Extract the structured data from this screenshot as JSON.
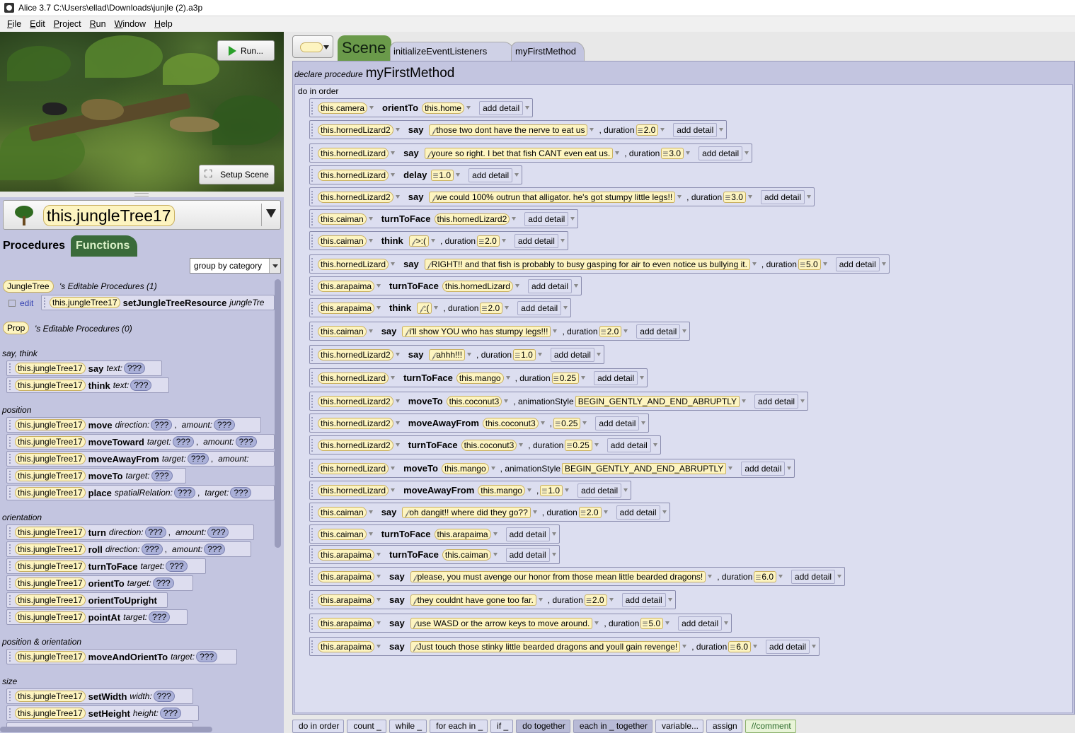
{
  "window": {
    "title": "Alice 3.7 C:\\Users\\ellad\\Downloads\\junjle (2).a3p"
  },
  "menu": [
    "File",
    "Edit",
    "Project",
    "Run",
    "Window",
    "Help"
  ],
  "scene_view": {
    "run_label": "Run...",
    "setup_label": "Setup Scene"
  },
  "selector": {
    "name": "this.jungleTree17"
  },
  "left_tabs": {
    "procedures": "Procedures",
    "functions": "Functions"
  },
  "group_by": "group by category",
  "editable": {
    "type1": "JungleTree",
    "type1_text": "'s Editable Procedures (1)",
    "edit_label": "edit",
    "proc_obj": "this.jungleTree17",
    "proc_name": "setJungleTreeResource",
    "proc_param": "jungleTre",
    "type2": "Prop",
    "type2_text": "'s Editable Procedures (0)"
  },
  "categories": {
    "say_think": "say, think",
    "position": "position",
    "orientation": "orientation",
    "pos_orient": "position & orientation",
    "size": "size"
  },
  "left_procs": {
    "obj": "this.jungleTree17",
    "q": "???",
    "say": {
      "name": "say",
      "param": "text:"
    },
    "think": {
      "name": "think",
      "param": "text:"
    },
    "move": {
      "name": "move",
      "p1": "direction:",
      "p2": "amount:"
    },
    "moveToward": {
      "name": "moveToward",
      "p1": "target:",
      "p2": "amount:"
    },
    "moveAwayFrom": {
      "name": "moveAwayFrom",
      "p1": "target:",
      "p2": "amount:"
    },
    "moveTo": {
      "name": "moveTo",
      "p1": "target:"
    },
    "place": {
      "name": "place",
      "p1": "spatialRelation:",
      "p2": "target:"
    },
    "turn": {
      "name": "turn",
      "p1": "direction:",
      "p2": "amount:"
    },
    "roll": {
      "name": "roll",
      "p1": "direction:",
      "p2": "amount:"
    },
    "turnToFace": {
      "name": "turnToFace",
      "p1": "target:"
    },
    "orientTo": {
      "name": "orientTo",
      "p1": "target:"
    },
    "orientToUpright": {
      "name": "orientToUpright"
    },
    "pointAt": {
      "name": "pointAt",
      "p1": "target:"
    },
    "moveAndOrientTo": {
      "name": "moveAndOrientTo",
      "p1": "target:"
    },
    "setWidth": {
      "name": "setWidth",
      "p1": "width:"
    },
    "setHeight": {
      "name": "setHeight",
      "p1": "height:"
    }
  },
  "editor_tabs": {
    "scene": "Scene",
    "init": "initializeEventListeners",
    "first": "myFirstMethod"
  },
  "declare": {
    "prefix": "declare procedure",
    "name": "myFirstMethod"
  },
  "do_in_order": "do in order",
  "add_detail": "add detail",
  "kw": {
    "duration": ", duration",
    "anim": ", animationStyle"
  },
  "statements": [
    {
      "obj": "this.camera",
      "method": "orientTo",
      "arg": "this.home"
    },
    {
      "obj": "this.hornedLizard2",
      "method": "say",
      "text": "those two dont have the nerve to eat us",
      "duration": "2.0"
    },
    {
      "obj": "this.hornedLizard",
      "method": "say",
      "text": "youre so right. I bet that fish CANT even eat us.",
      "duration": "3.0"
    },
    {
      "obj": "this.hornedLizard",
      "method": "delay",
      "num": "1.0"
    },
    {
      "obj": "this.hornedLizard2",
      "method": "say",
      "text": "we could 100% outrun that alligator. he's got stumpy little legs!!",
      "duration": "3.0"
    },
    {
      "obj": "this.caiman",
      "method": "turnToFace",
      "arg": "this.hornedLizard2"
    },
    {
      "obj": "this.caiman",
      "method": "think",
      "text": ">:(",
      "duration": "2.0"
    },
    {
      "obj": "this.hornedLizard",
      "method": "say",
      "text": "RIGHT!! and that fish is probably to busy gasping for air to even notice us bullying it.",
      "duration": "5.0"
    },
    {
      "obj": "this.arapaima",
      "method": "turnToFace",
      "arg": "this.hornedLizard"
    },
    {
      "obj": "this.arapaima",
      "method": "think",
      "text": ":(",
      "duration": "2.0"
    },
    {
      "obj": "this.caiman",
      "method": "say",
      "text": "i'll show YOU who has stumpy legs!!!",
      "duration": "2.0"
    },
    {
      "obj": "this.hornedLizard2",
      "method": "say",
      "text": "ahhh!!!",
      "duration": "1.0"
    },
    {
      "obj": "this.hornedLizard",
      "method": "turnToFace",
      "arg": "this.mango",
      "duration": "0.25"
    },
    {
      "obj": "this.hornedLizard2",
      "method": "moveTo",
      "arg": "this.coconut3",
      "anim": "BEGIN_GENTLY_AND_END_ABRUPTLY"
    },
    {
      "obj": "this.hornedLizard2",
      "method": "moveAwayFrom",
      "arg": "this.coconut3",
      "num": "0.25"
    },
    {
      "obj": "this.hornedLizard2",
      "method": "turnToFace",
      "arg": "this.coconut3",
      "duration": "0.25"
    },
    {
      "obj": "this.hornedLizard",
      "method": "moveTo",
      "arg": "this.mango",
      "anim": "BEGIN_GENTLY_AND_END_ABRUPTLY"
    },
    {
      "obj": "this.hornedLizard",
      "method": "moveAwayFrom",
      "arg": "this.mango",
      "num": "1.0"
    },
    {
      "obj": "this.caiman",
      "method": "say",
      "text": "oh dangit!! where did they go??",
      "duration": "2.0"
    },
    {
      "obj": "this.caiman",
      "method": "turnToFace",
      "arg": "this.arapaima"
    },
    {
      "obj": "this.arapaima",
      "method": "turnToFace",
      "arg": "this.caiman"
    },
    {
      "obj": "this.arapaima",
      "method": "say",
      "text": "please, you must avenge our honor from those mean little bearded dragons!",
      "duration": "6.0"
    },
    {
      "obj": "this.arapaima",
      "method": "say",
      "text": "they couldnt have gone too far.",
      "duration": "2.0"
    },
    {
      "obj": "this.arapaima",
      "method": "say",
      "text": "use WASD or the arrow keys to move around. ",
      "duration": "5.0"
    },
    {
      "obj": "this.arapaima",
      "method": "say",
      "text": "Just touch those stinky little bearded dragons and youll gain revenge!",
      "duration": "6.0"
    }
  ],
  "controls": [
    "do in order",
    "count _",
    "while _",
    "for each in _",
    "if _",
    "do together",
    "each in _ together",
    "variable...",
    "assign",
    "//comment"
  ]
}
